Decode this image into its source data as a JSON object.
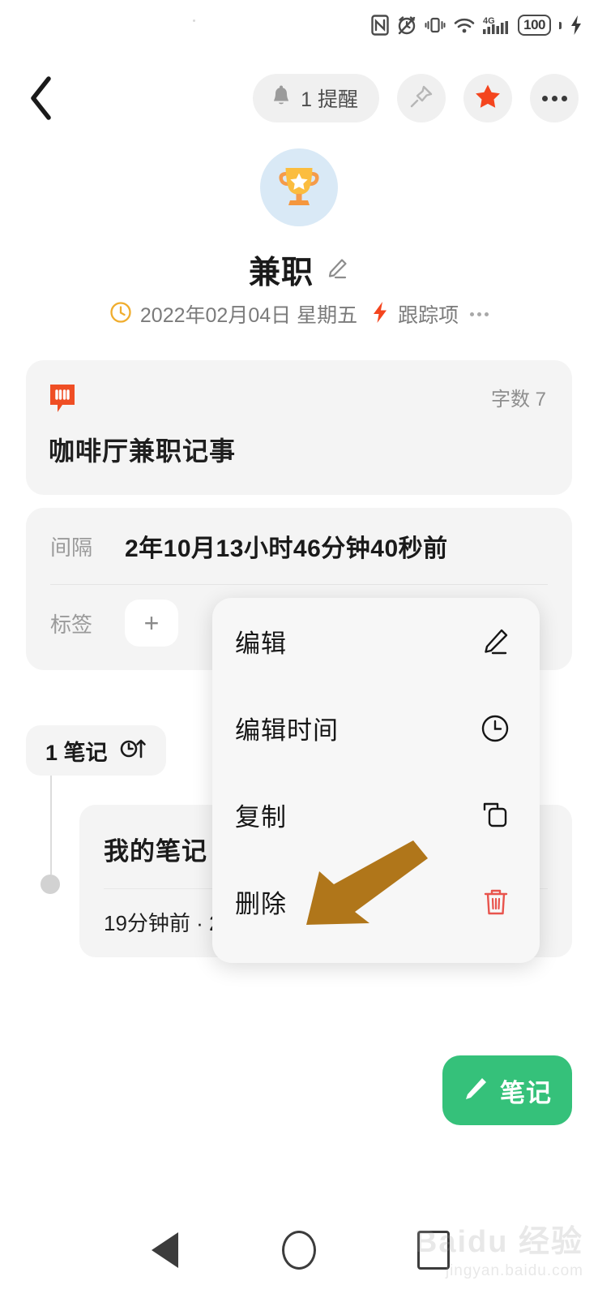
{
  "status_bar": {
    "icons": [
      "nfc-icon",
      "alarm-off-icon",
      "vibrate-icon",
      "wifi-icon",
      "signal-4g-icon",
      "battery-icon"
    ],
    "network_label": "4G",
    "battery_level": "100",
    "charging": true
  },
  "topbar": {
    "back_icon": "chevron-left-icon",
    "reminder_label": "1 提醒",
    "reminder_icon": "bell-icon",
    "pin_icon": "pin-icon",
    "star_icon": "star-icon",
    "more_icon": "more-dots-icon",
    "star_color": "#f4451e"
  },
  "header": {
    "avatar_icon": "trophy-icon",
    "avatar_bg": "#d9e9f6",
    "title": "兼职",
    "edit_title_icon": "pencil-icon",
    "meta": {
      "clock_icon": "clock-icon",
      "date": "2022年02月04日 星期五",
      "lightning_icon": "lightning-icon",
      "tracker_label": "跟踪项",
      "more_icon": "more-dots-icon"
    }
  },
  "quote_card": {
    "icon": "quote-bubble-icon",
    "icon_color": "#ef4e24",
    "word_count_label": "字数",
    "word_count_value": "7",
    "text": "咖啡厅兼职记事"
  },
  "interval_card": {
    "interval_key": "间隔",
    "interval_value": "2年10月13小时46分钟40秒前",
    "tag_key": "标签",
    "tag_add_icon": "plus-icon"
  },
  "notes": {
    "chip_label": "1 笔记",
    "chip_sort_icon": "clock-ascending-icon",
    "item": {
      "title": "我的笔记",
      "subtitle": "19分钟前 · 2"
    }
  },
  "menu": {
    "items": [
      {
        "label": "编辑",
        "icon": "pencil-icon",
        "color": "#161616"
      },
      {
        "label": "编辑时间",
        "icon": "clock-icon",
        "color": "#161616"
      },
      {
        "label": "复制",
        "icon": "copy-icon",
        "color": "#161616"
      },
      {
        "label": "删除",
        "icon": "trash-icon",
        "color": "#e8544d"
      }
    ]
  },
  "annotation": {
    "arrow_icon": "arrow-pointing-down-left-icon",
    "arrow_color": "#b0761a"
  },
  "fab": {
    "label": "笔记",
    "icon": "pencil-icon",
    "color": "#35c17a"
  },
  "navbar": {
    "back_icon": "nav-back-triangle-icon",
    "home_icon": "nav-home-circle-icon",
    "recents_icon": "nav-recents-square-icon"
  },
  "watermark": {
    "main": "Baidu 经验",
    "sub": "jingyan.baidu.com"
  }
}
